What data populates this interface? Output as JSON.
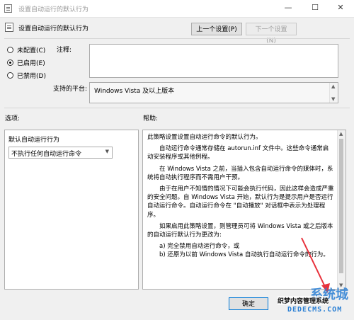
{
  "window": {
    "title": "设置自动运行的默认行为",
    "controls": {
      "minimize": "—",
      "maximize": "☐",
      "close": "✕"
    }
  },
  "header": {
    "policy_title": "设置自动运行的默认行为",
    "prev_button": "上一个设置(P)",
    "next_button": "下一个设置(N)"
  },
  "radios": [
    {
      "label": "未配置(C)",
      "checked": false
    },
    {
      "label": "已启用(E)",
      "checked": true
    },
    {
      "label": "已禁用(D)",
      "checked": false
    }
  ],
  "comment": {
    "label": "注释:",
    "value": ""
  },
  "platform": {
    "label": "支持的平台:",
    "value": "Windows Vista 及以上版本"
  },
  "options": {
    "section_label": "选项:",
    "field_label": "默认自动运行行为",
    "selected": "不执行任何自动运行命令"
  },
  "help": {
    "section_label": "帮助:",
    "paragraphs": [
      "此策略设置设置自动运行命令的默认行为。",
      "自动运行命令通常存储在 autorun.inf 文件中。这些命令通常启动安装程序或其他例程。",
      "在 Windows Vista 之前，当插入包含自动运行命令的媒体时，系统将自动执行程序而不需用户干预。",
      "由于在用户不知情的情况下可能会执行代码，因此这样会造成严重的安全问题。自 Windows Vista 开始，默认行为是提示用户是否运行自动运行命令。自动运行命令在 \"自动播放\" 对话框中表示为处理程序。",
      "如果启用此策略设置，则管理员可将 Windows Vista 或之后版本的自动运行默认行为更改为:",
      "a) 完全禁用自动运行命令，或",
      "b) 还原为以前 Windows Vista 自动执行自动运行命令的行为。"
    ]
  },
  "footer": {
    "ok_button": "确定"
  },
  "watermark": {
    "logo": "系统城",
    "sub": "织梦内容管理系统",
    "url": "DEDECMS.COM"
  },
  "colors": {
    "annotation_arrow": "#e8323c",
    "watermark_blue": "#2a7fd4"
  }
}
